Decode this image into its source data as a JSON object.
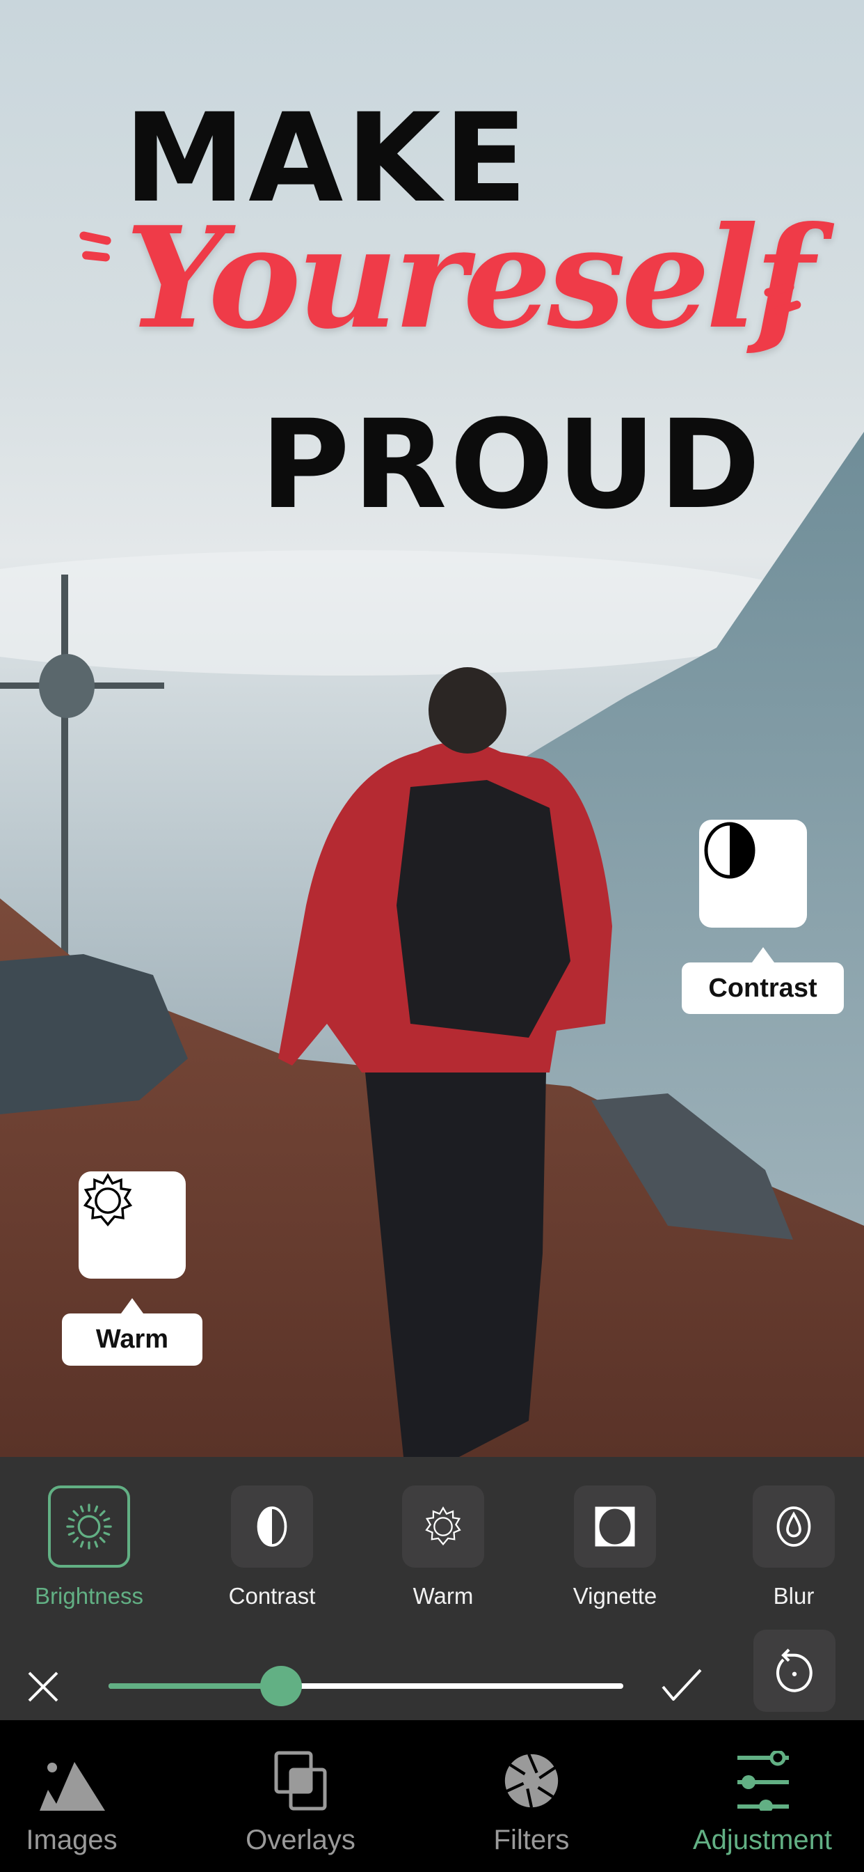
{
  "poster": {
    "line1": "MAKE",
    "line2": "Youreself",
    "line3": "PROUD",
    "accent_color": "#ef3b48"
  },
  "callouts": [
    {
      "icon": "contrast-icon",
      "label": "Contrast"
    },
    {
      "icon": "warm-sun-icon",
      "label": "Warm"
    }
  ],
  "tools": [
    {
      "icon": "brightness-icon",
      "label": "Brightness",
      "active": true
    },
    {
      "icon": "contrast-icon",
      "label": "Contrast",
      "active": false
    },
    {
      "icon": "warm-icon",
      "label": "Warm",
      "active": false
    },
    {
      "icon": "vignette-icon",
      "label": "Vignette",
      "active": false
    },
    {
      "icon": "blur-icon",
      "label": "Blur",
      "active": false
    }
  ],
  "slider": {
    "value": 0.335,
    "color": "#62b084"
  },
  "nav": [
    {
      "icon": "images-icon",
      "label": "Images",
      "active": false
    },
    {
      "icon": "overlays-icon",
      "label": "Overlays",
      "active": false
    },
    {
      "icon": "filters-icon",
      "label": "Filters",
      "active": false
    },
    {
      "icon": "adjustment-icon",
      "label": "Adjustment",
      "active": true
    }
  ],
  "colors": {
    "active": "#62b084",
    "toolbar_bg": "#333333",
    "nav_bg": "#000000"
  }
}
